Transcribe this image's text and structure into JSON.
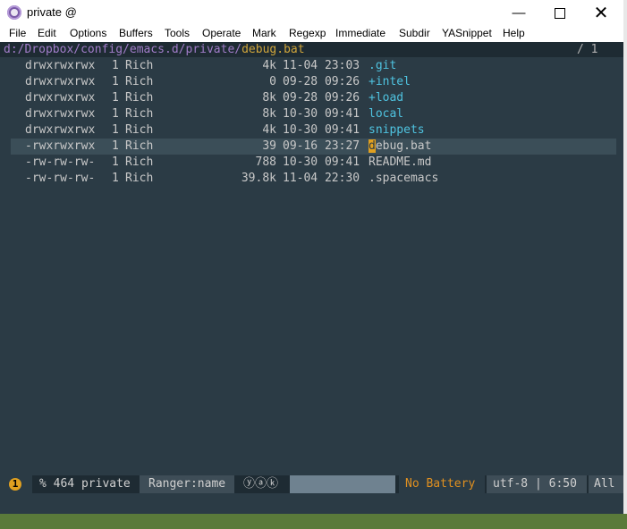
{
  "window": {
    "title": "private @",
    "controls": {
      "minimize": "—",
      "close": "✕"
    }
  },
  "menu": [
    "File",
    "Edit",
    "Options",
    "Buffers",
    "Tools",
    "Operate",
    "Mark",
    "Regexp",
    "Immediate",
    "Subdir",
    "YASnippet",
    "Help"
  ],
  "header": {
    "path_dir": "d:/Dropbox/config/emacs.d/private/",
    "path_file": "debug.bat",
    "position": "/ 1"
  },
  "files": [
    {
      "perm": "drwxrwxrwx",
      "links": "1",
      "owner": "Rich",
      "size": "4k",
      "date": "11-04 23:03",
      "name": ".git",
      "is_dir": true
    },
    {
      "perm": "drwxrwxrwx",
      "links": "1",
      "owner": "Rich",
      "size": "0",
      "date": "09-28 09:26",
      "name": "+intel",
      "is_dir": true
    },
    {
      "perm": "drwxrwxrwx",
      "links": "1",
      "owner": "Rich",
      "size": "8k",
      "date": "09-28 09:26",
      "name": "+load",
      "is_dir": true
    },
    {
      "perm": "drwxrwxrwx",
      "links": "1",
      "owner": "Rich",
      "size": "8k",
      "date": "10-30 09:41",
      "name": "local",
      "is_dir": true
    },
    {
      "perm": "drwxrwxrwx",
      "links": "1",
      "owner": "Rich",
      "size": "4k",
      "date": "10-30 09:41",
      "name": "snippets",
      "is_dir": true
    },
    {
      "perm": "-rwxrwxrwx",
      "links": "1",
      "owner": "Rich",
      "size": "39",
      "date": "09-16 23:27",
      "name": "debug.bat",
      "is_dir": false,
      "selected": true
    },
    {
      "perm": "-rw-rw-rw-",
      "links": "1",
      "owner": "Rich",
      "size": "788",
      "date": "10-30 09:41",
      "name": "README.md",
      "is_dir": false
    },
    {
      "perm": "-rw-rw-rw-",
      "links": "1",
      "owner": "Rich",
      "size": "39.8k",
      "date": "11-04 22:30",
      "name": ".spacemacs",
      "is_dir": false
    }
  ],
  "modeline": {
    "window_number": "1",
    "buffer": "% 464 private",
    "mode": "Ranger:name",
    "icons": "ⓨⓐⓚ",
    "battery": "No Battery",
    "encoding": "utf-8 | 6:50",
    "scroll": "All"
  },
  "colors": {
    "background": "#2b3b45",
    "directory": "#4fc3e0",
    "cursor": "#e0a020",
    "battery_warning": "#e09020"
  }
}
